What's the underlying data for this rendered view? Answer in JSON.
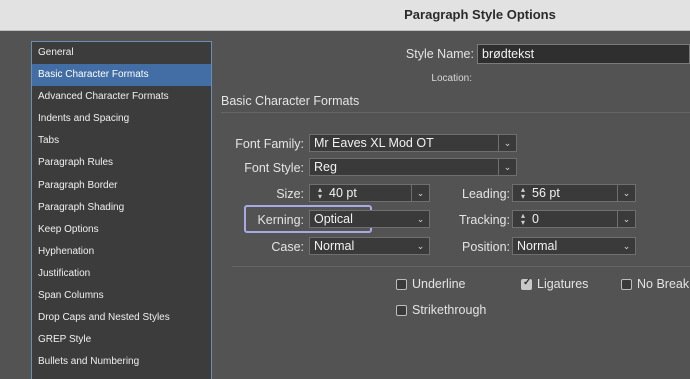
{
  "window": {
    "title": "Paragraph Style Options"
  },
  "sidebar": {
    "selected_index": 1,
    "items": [
      {
        "label": "General"
      },
      {
        "label": "Basic Character Formats"
      },
      {
        "label": "Advanced Character Formats"
      },
      {
        "label": "Indents and Spacing"
      },
      {
        "label": "Tabs"
      },
      {
        "label": "Paragraph Rules"
      },
      {
        "label": "Paragraph Border"
      },
      {
        "label": "Paragraph Shading"
      },
      {
        "label": "Keep Options"
      },
      {
        "label": "Hyphenation"
      },
      {
        "label": "Justification"
      },
      {
        "label": "Span Columns"
      },
      {
        "label": "Drop Caps and Nested Styles"
      },
      {
        "label": "GREP Style"
      },
      {
        "label": "Bullets and Numbering"
      }
    ]
  },
  "header": {
    "style_name_label": "Style Name:",
    "style_name_value": "brødtekst",
    "location_label": "Location:"
  },
  "section": {
    "title": "Basic Character Formats"
  },
  "form": {
    "font_family_label": "Font Family:",
    "font_family_value": "Mr Eaves XL Mod OT",
    "font_style_label": "Font Style:",
    "font_style_value": "Reg",
    "size_label": "Size:",
    "size_value": "40 pt",
    "leading_label": "Leading:",
    "leading_value": "56 pt",
    "kerning_label": "Kerning:",
    "kerning_value": "Optical",
    "tracking_label": "Tracking:",
    "tracking_value": "0",
    "case_label": "Case:",
    "case_value": "Normal",
    "position_label": "Position:",
    "position_value": "Normal"
  },
  "options": {
    "underline_label": "Underline",
    "underline_checked": false,
    "ligatures_label": "Ligatures",
    "ligatures_checked": true,
    "nobreak_label": "No Break",
    "nobreak_checked": false,
    "strikethrough_label": "Strikethrough",
    "strikethrough_checked": false
  },
  "icons": {
    "dropdown": "chevron-down-icon",
    "spinner": "stepper-icon",
    "checkbox": "checkbox-icon"
  },
  "colors": {
    "panel_bg": "#535353",
    "sidebar_bg": "#3c3c3c",
    "selected_bg": "#426ea5",
    "titlebar_bg": "#e2e2e2",
    "kerning_highlight": "#a9a9e8"
  }
}
